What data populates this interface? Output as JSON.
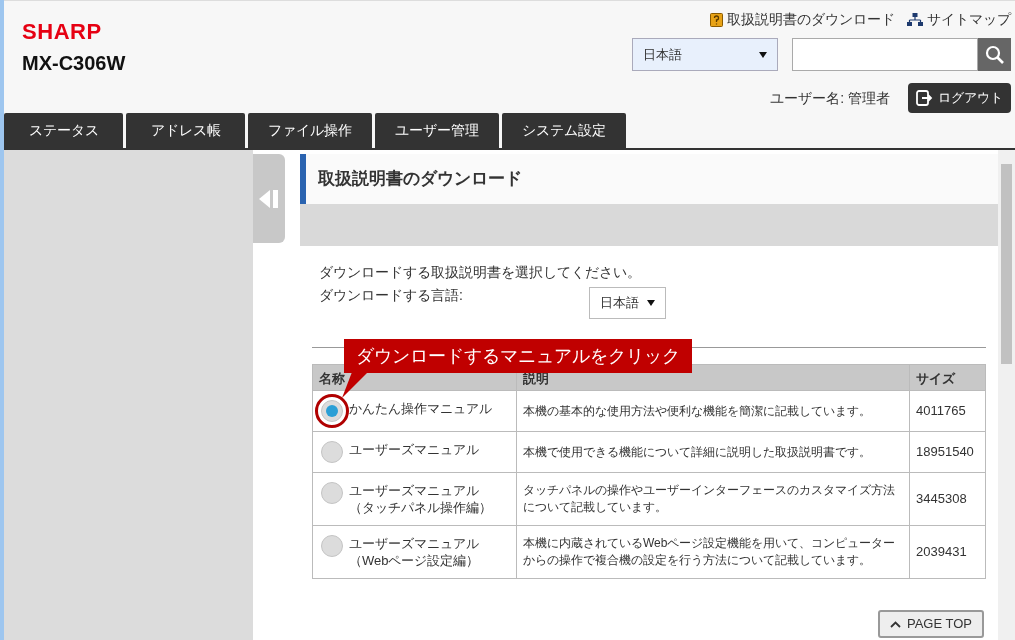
{
  "header": {
    "logo": "SHARP",
    "model": "MX-C306W",
    "links": [
      {
        "kind": "manual",
        "label": "取扱説明書のダウンロード"
      },
      {
        "kind": "sitemap",
        "label": "サイトマップ"
      }
    ],
    "language_select": {
      "value": "日本語"
    },
    "user": "ユーザー名: 管理者",
    "logout": "ログアウト"
  },
  "tabs": [
    {
      "label": "ステータス",
      "selected": false
    },
    {
      "label": "アドレス帳",
      "selected": false
    },
    {
      "label": "ファイル操作",
      "selected": false
    },
    {
      "label": "ユーザー管理",
      "selected": false
    },
    {
      "label": "システム設定",
      "selected": false
    }
  ],
  "content": {
    "title": "取扱説明書のダウンロード",
    "instruction": "ダウンロードする取扱説明書を選択してください。",
    "language_label": "ダウンロードする言語:",
    "language_select": {
      "value": "日本語"
    },
    "callout": "ダウンロードするマニュアルをクリック",
    "table": {
      "columns": [
        "名称",
        "説明",
        "サイズ"
      ],
      "rows": [
        {
          "name": "かんたん操作マニュアル",
          "description": "本機の基本的な使用方法や便利な機能を簡潔に記載しています。",
          "size": "4011765",
          "selected": true
        },
        {
          "name": "ユーザーズマニュアル",
          "description": "本機で使用できる機能について詳細に説明した取扱説明書です。",
          "size": "18951540",
          "selected": false
        },
        {
          "name": "ユーザーズマニュアル（タッチパネル操作編）",
          "description": "タッチパネルの操作やユーザーインターフェースのカスタマイズ方法について記載しています。",
          "size": "3445308",
          "selected": false
        },
        {
          "name": "ユーザーズマニュアル（Webページ設定編）",
          "description": "本機に内蔵されているWebページ設定機能を用いて、コンピューターからの操作で複合機の設定を行う方法について記載しています。",
          "size": "2039431",
          "selected": false
        }
      ]
    },
    "page_top": "PAGE TOP"
  }
}
